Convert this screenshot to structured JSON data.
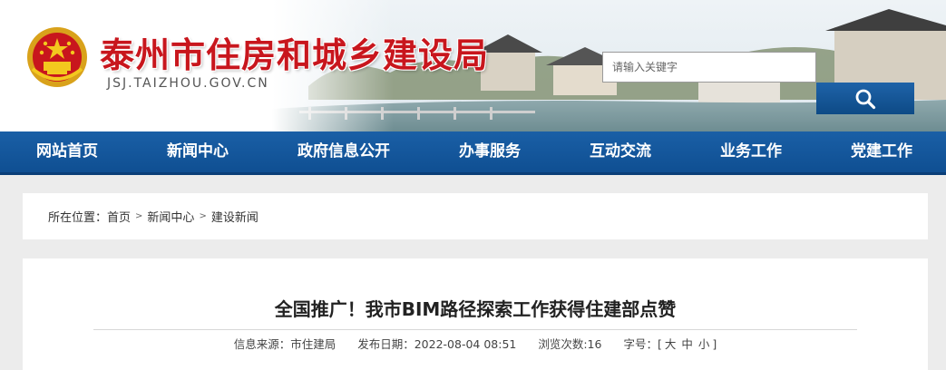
{
  "header": {
    "title": "泰州市住房和城乡建设局",
    "domain": "JSJ.TAIZHOU.GOV.CN",
    "search_placeholder": "请输入关键字",
    "colors": {
      "title_red": "#c8161d",
      "nav_blue": "#1a5fa6"
    }
  },
  "nav": {
    "items": [
      "网站首页",
      "新闻中心",
      "政府信息公开",
      "办事服务",
      "互动交流",
      "业务工作",
      "党建工作"
    ]
  },
  "breadcrumb": {
    "prefix": "所在位置：",
    "separator": ">",
    "items": [
      "首页",
      "新闻中心",
      "建设新闻"
    ]
  },
  "article": {
    "title": "全国推广！我市BIM路径探索工作获得住建部点赞",
    "source": "信息来源：市住建局",
    "published": "发布日期：2022-08-04 08:51",
    "views": "浏览次数:16",
    "font_size_label": "字号：[",
    "font_size_close": "]",
    "font_sizes": [
      "大",
      "中",
      "小"
    ]
  }
}
